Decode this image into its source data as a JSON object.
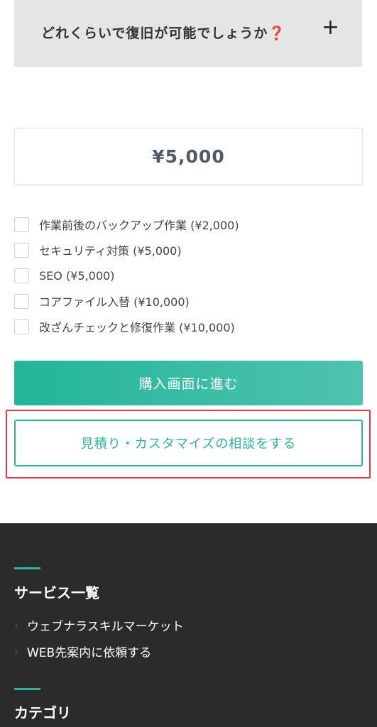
{
  "faq": {
    "question": "どれくらいで復旧が可能でしょうか",
    "question_mark": "❓",
    "toggle_symbol": "+"
  },
  "price": {
    "value": "¥5,000"
  },
  "options": [
    {
      "label": "作業前後のバックアップ作業 (¥2,000)",
      "checked": false
    },
    {
      "label": "セキュリティ対策 (¥5,000)",
      "checked": false
    },
    {
      "label": "SEO (¥5,000)",
      "checked": false
    },
    {
      "label": "コアファイル入替 (¥10,000)",
      "checked": false
    },
    {
      "label": "改ざんチェックと修復作業 (¥10,000)",
      "checked": false
    }
  ],
  "buttons": {
    "buy_label": "購入画面に進む",
    "consult_label": "見積り・カスタマイズの相談をする"
  },
  "footer": {
    "services_heading": "サービス一覧",
    "service_links": [
      {
        "label": "ウェブナラスキルマーケット"
      },
      {
        "label": "WEB先案内に依頼する"
      }
    ],
    "category_heading": "カテゴリ"
  },
  "colors": {
    "accent": "#2fb39b",
    "highlight": "#e63946",
    "footer_bg": "#2b2b2b"
  }
}
